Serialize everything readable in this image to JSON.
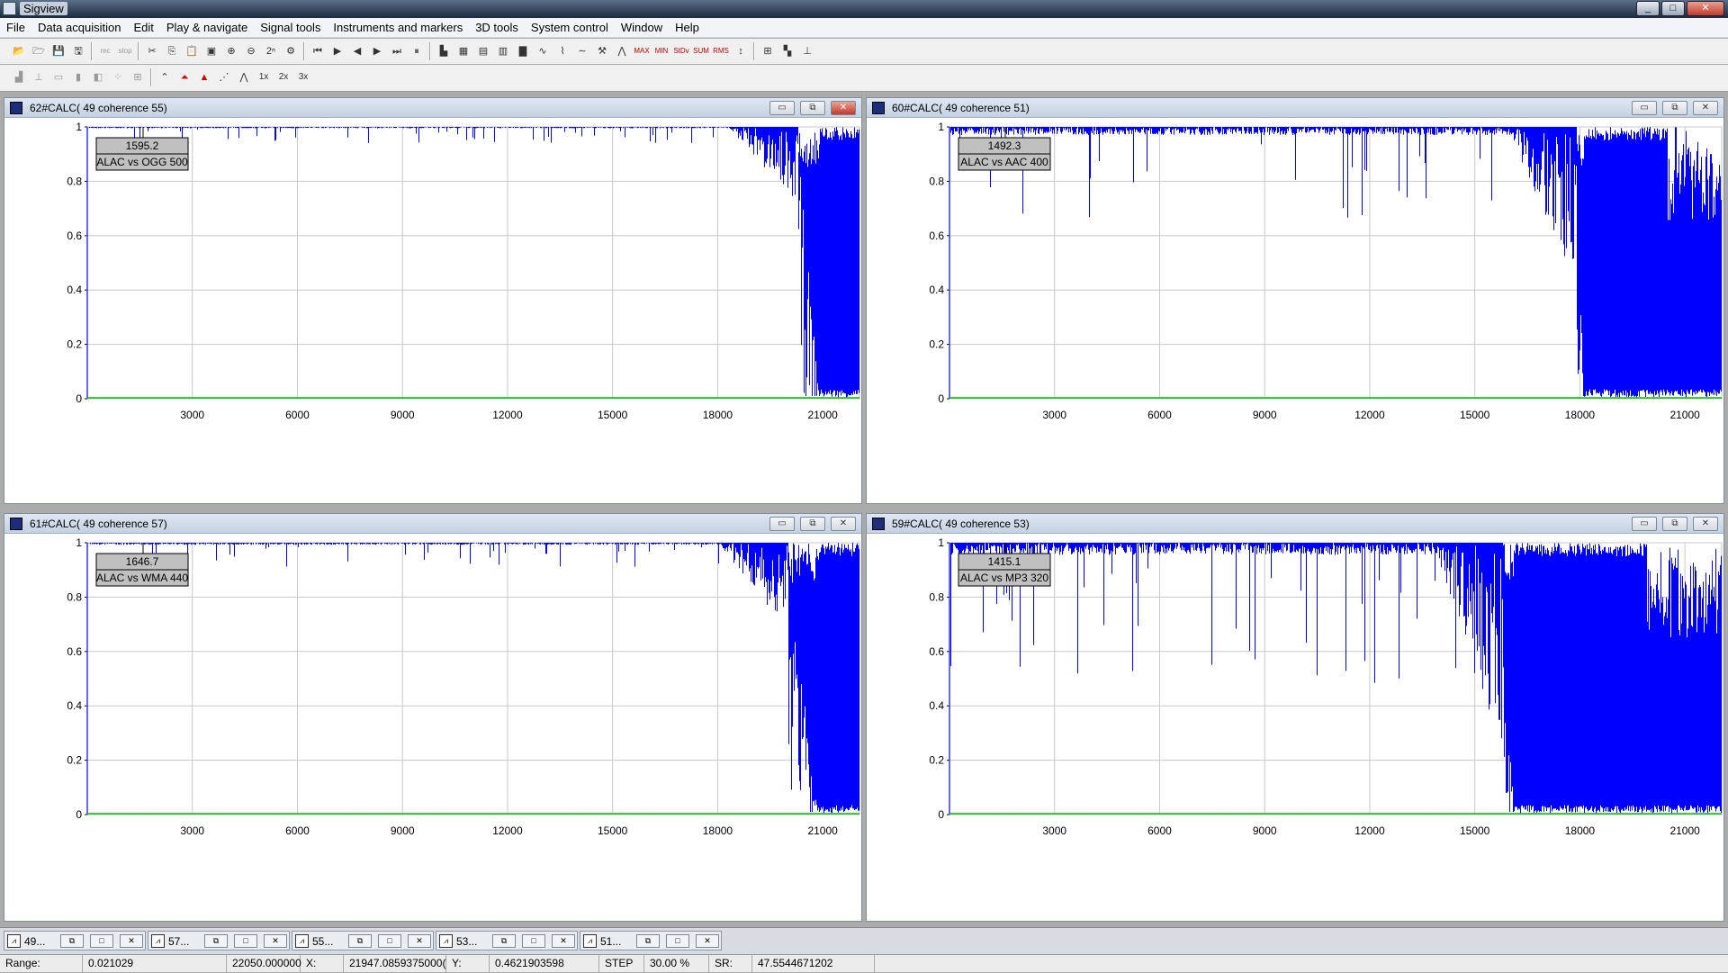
{
  "window": {
    "title": "Sigview"
  },
  "menu": [
    "File",
    "Data acquisition",
    "Edit",
    "Play & navigate",
    "Signal tools",
    "Instruments and markers",
    "3D tools",
    "System control",
    "Window",
    "Help"
  ],
  "toolbar1": [
    "open",
    "open-all",
    "save",
    "save-as",
    "rec",
    "rec-stop",
    "cut",
    "copy",
    "paste",
    "image",
    "zoom-in",
    "zoom-out",
    "2n",
    "settings",
    "first",
    "play",
    "prev-marker",
    "next-marker",
    "last",
    "pause",
    "spectrum",
    "spectrogram",
    "calculator",
    "histogram",
    "bars",
    "wave",
    "filter",
    "stats",
    "tools",
    "peak",
    "max",
    "min",
    "stdev",
    "sum",
    "rms",
    "cursor",
    "layout-1",
    "layout-2",
    "layout-3"
  ],
  "toolbar1_labels": {
    "rec": "rec",
    "rec_stop": "stop",
    "max": "MAX",
    "min": "MIN",
    "stdev": "StDv",
    "sum": "SUM",
    "rms": "RMS",
    "two_n": "2ⁿ"
  },
  "toolbar2": [
    "line-style",
    "dots",
    "bars",
    "steps",
    "split",
    "mix",
    "grid",
    "peak-line",
    "peak-red",
    "peak-fill",
    "dots-line",
    "peak-dash"
  ],
  "toolbar2_labels": {
    "x1": "1x",
    "x2": "2x",
    "x3": "3x"
  },
  "panels": [
    {
      "title": "62#CALC( 49 coherence 55)",
      "marker_value": "1595.2",
      "marker_label": "ALAC vs OGG 500",
      "active": true,
      "cutoff": 20300,
      "floor_start": 20900,
      "noise": 0.02
    },
    {
      "title": "60#CALC( 49 coherence 51)",
      "marker_value": "1492.3",
      "marker_label": "ALAC vs AAC 400",
      "active": false,
      "cutoff": 17900,
      "floor_start": 18100,
      "noise": 0.12
    },
    {
      "title": "61#CALC( 49 coherence 57)",
      "marker_value": "1646.7",
      "marker_label": "ALAC vs WMA 440",
      "active": false,
      "cutoff": 20000,
      "floor_start": 20900,
      "noise": 0.03
    },
    {
      "title": "59#CALC( 49 coherence 53)",
      "marker_value": "1415.1",
      "marker_label": "ALAC vs MP3 320",
      "active": false,
      "cutoff": 15800,
      "floor_start": 16100,
      "noise": 0.18
    }
  ],
  "axes": {
    "x_ticks": [
      "3000",
      "6000",
      "9000",
      "12000",
      "15000",
      "18000",
      "21000"
    ],
    "x_values": [
      3000,
      6000,
      9000,
      12000,
      15000,
      18000,
      21000
    ],
    "y_ticks": [
      "1",
      "0.8",
      "0.6",
      "0.4",
      "0.2",
      "0"
    ],
    "y_values": [
      1,
      0.8,
      0.6,
      0.4,
      0.2,
      0
    ],
    "xlim": [
      0,
      22050
    ],
    "ylim": [
      0,
      1
    ],
    "grid": true
  },
  "colors": {
    "signal": "#0000ff",
    "baseline": "#00c000",
    "grid": "#c8c8c8",
    "marker_box": "#c0c0c0"
  },
  "taskbar": [
    {
      "label": "49..."
    },
    {
      "label": "57..."
    },
    {
      "label": "55..."
    },
    {
      "label": "53..."
    },
    {
      "label": "51..."
    }
  ],
  "status": {
    "range_label": "Range:",
    "range_min": "0.021029",
    "range_max": "22050.000000",
    "x_label": "X:",
    "x_value": "21947.0859375000(",
    "y_label": "Y:",
    "y_value": "0.4621903598",
    "step_label": "STEP",
    "step_value": "30.00 %",
    "sr_label": "SR:",
    "sr_value": "47.5544671202"
  }
}
